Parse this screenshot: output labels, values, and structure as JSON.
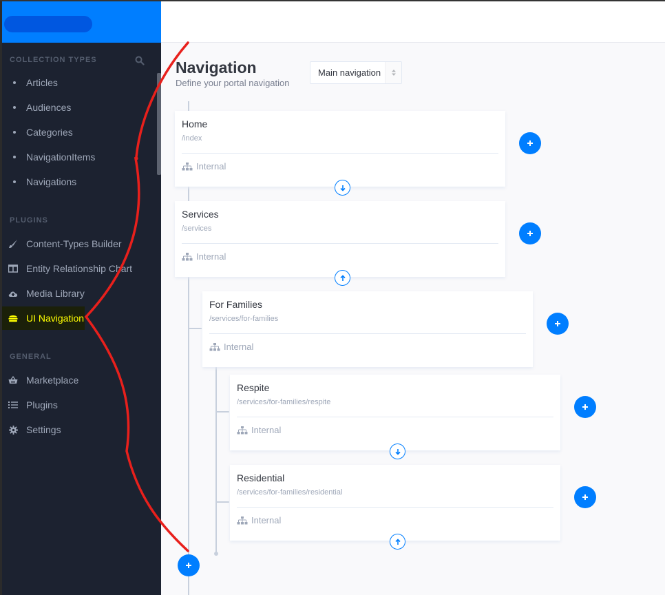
{
  "sidebar": {
    "collection_types_title": "COLLECTION TYPES",
    "collection_types": [
      {
        "label": "Articles"
      },
      {
        "label": "Audiences"
      },
      {
        "label": "Categories"
      },
      {
        "label": "NavigationItems"
      },
      {
        "label": "Navigations"
      }
    ],
    "plugins_title": "PLUGINS",
    "plugins": [
      {
        "label": "Content-Types Builder",
        "icon": "paintbrush-icon"
      },
      {
        "label": "Entity Relationship Chart",
        "icon": "columns-icon"
      },
      {
        "label": "Media Library",
        "icon": "cloud-upload-icon"
      },
      {
        "label": "UI Navigation",
        "icon": "hamburger-icon",
        "active": true
      }
    ],
    "general_title": "GENERAL",
    "general": [
      {
        "label": "Marketplace",
        "icon": "basket-icon"
      },
      {
        "label": "Plugins",
        "icon": "list-icon"
      },
      {
        "label": "Settings",
        "icon": "gear-icon"
      }
    ]
  },
  "header": {
    "title": "Navigation",
    "subtitle": "Define your portal navigation",
    "navigation_select": "Main navigation"
  },
  "items": [
    {
      "title": "Home",
      "path": "/index",
      "type": "Internal",
      "move": "down"
    },
    {
      "title": "Services",
      "path": "/services",
      "type": "Internal",
      "move": "up"
    },
    {
      "title": "For Families",
      "path": "/services/for-families",
      "type": "Internal",
      "move": null
    },
    {
      "title": "Respite",
      "path": "/services/for-families/respite",
      "type": "Internal",
      "move": "down"
    },
    {
      "title": "Residential",
      "path": "/services/for-families/residential",
      "type": "Internal",
      "move": "up"
    }
  ],
  "colors": {
    "accent": "#007eff",
    "sidebar_bg": "#1c2230",
    "active_text": "#ffff00",
    "annotation": "#e8201c"
  }
}
